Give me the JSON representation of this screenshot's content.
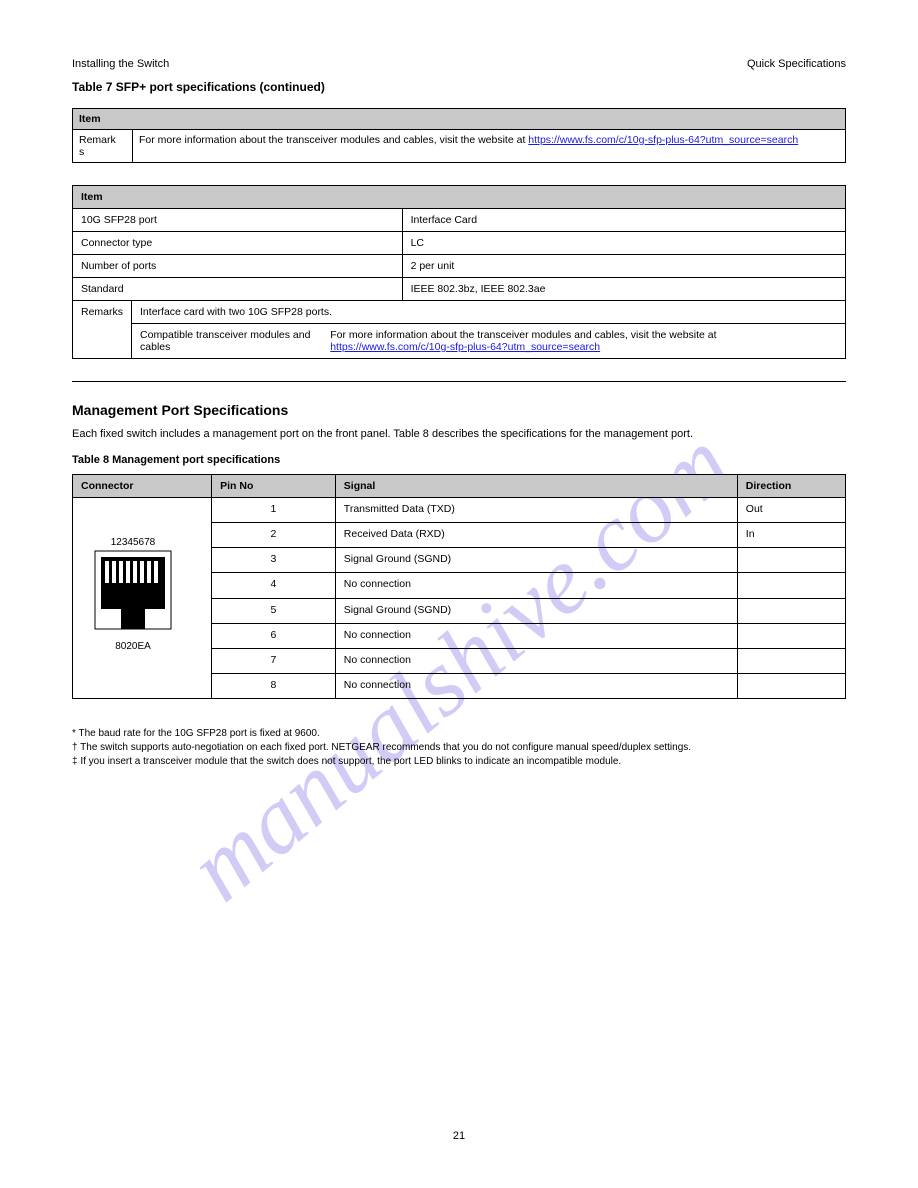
{
  "header": {
    "left": "Installing the Switch",
    "right": "Quick Specifications"
  },
  "page_title": "Table 7   SFP+ port specifications (continued)",
  "table1": {
    "header": "Item",
    "row_label1": "Remark",
    "row_label2": "s",
    "text_prefix": "For more information about the transceiver modules and cables, visit the website at",
    "url": "https://www.fs.com/c/10g-sfp-plus-64?utm_source=search"
  },
  "table2": {
    "header": "Item",
    "rows": [
      {
        "l": "10G SFP28 port",
        "r": "Interface Card"
      },
      {
        "l": "Connector type",
        "r": "LC"
      },
      {
        "l": "Number of ports",
        "r": "2 per unit"
      },
      {
        "l": "Standard",
        "r": "IEEE 802.3bz, IEEE 802.3ae"
      }
    ],
    "remark_label": "Remarks",
    "remark_text": "Interface card with two 10G SFP28 ports.",
    "compat_cell": "Compatible transceiver modules and cables",
    "compat_text": "For more information about the transceiver modules and cables, visit the website at",
    "compat_url": "https://www.fs.com/c/10g-sfp-plus-64?utm_source=search"
  },
  "section_title": "Management Port Specifications",
  "section_para": "Each fixed switch includes a management port on the front panel. Table 8 describes the specifications for the management port.",
  "table3_title": "Table 8   Management port specifications",
  "table3": {
    "head": [
      "Connector",
      "Pin No",
      "Signal",
      "Direction"
    ],
    "conn_label": "12345678",
    "conn_sub": "8020EA",
    "rows": [
      [
        "1",
        "Transmitted Data (TXD)",
        "Out"
      ],
      [
        "2",
        "Received Data (RXD)",
        "In"
      ],
      [
        "3",
        "Signal Ground (SGND)",
        ""
      ],
      [
        "4",
        "No connection",
        ""
      ],
      [
        "5",
        "Signal Ground (SGND)",
        ""
      ],
      [
        "6",
        "No connection",
        ""
      ],
      [
        "7",
        "No connection",
        ""
      ],
      [
        "8",
        "No connection",
        ""
      ]
    ]
  },
  "footnotes": [
    "* The baud rate for the 10G SFP28 port is fixed at 9600.",
    "† The switch supports auto-negotiation on each fixed port. NETGEAR recommends that you do not configure manual speed/duplex settings.",
    "‡ If you insert a transceiver module that the switch does not support, the port LED blinks to indicate an incompatible module."
  ],
  "pagenum": "21"
}
